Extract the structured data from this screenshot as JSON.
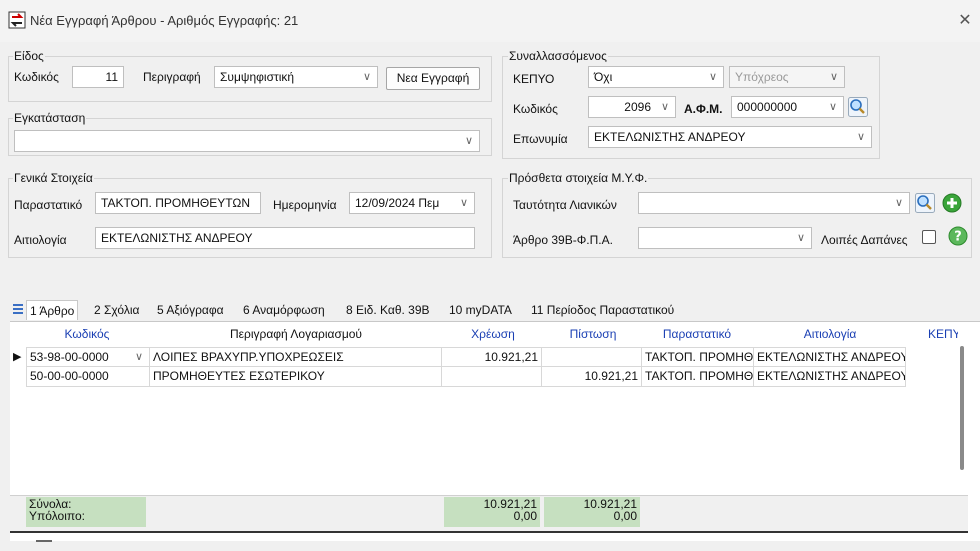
{
  "window": {
    "title": "Νέα Εγγραφή Άρθρου - Αριθμός Εγγραφής: 21",
    "close": "✕"
  },
  "eidos": {
    "legend": "Είδος",
    "code_label": "Κωδικός",
    "code_value": "11",
    "desc_label": "Περιγραφή",
    "desc_value": "Συμψηφιστική",
    "new_button": "Νεα Εγγραφή"
  },
  "egkatastasi": {
    "legend": "Εγκατάσταση",
    "value": ""
  },
  "synallassomenos": {
    "legend": "Συναλλασσόμενος",
    "kepyo_label": "ΚΕΠΥΟ",
    "kepyo_value": "Όχι",
    "ypoxreos_value": "Υπόχρεος",
    "code_label": "Κωδικός",
    "code_value": "2096",
    "afm_label": "Α.Φ.Μ.",
    "afm_value": "000000000",
    "name_label": "Επωνυμία",
    "name_value": "ΕΚΤΕΛΩΝΙΣΤΗΣ ΑΝΔΡΕΟΥ"
  },
  "genika": {
    "legend": "Γενικά Στοιχεία",
    "parastatiko_label": "Παραστατικό",
    "parastatiko_value": "ΤΑΚΤΟΠ. ΠΡΟΜΗΘΕΥΤΩΝ",
    "date_label": "Ημερομηνία",
    "date_value": "12/09/2024 Πεμ",
    "aitiologia_label": "Αιτιολογία",
    "aitiologia_value": "ΕΚΤΕΛΩΝΙΣΤΗΣ ΑΝΔΡΕΟΥ"
  },
  "prostheta": {
    "legend": "Πρόσθετα στοιχεία Μ.Υ.Φ.",
    "tautotita_label": "Ταυτότητα Λιανικών",
    "tautotita_value": "",
    "arthro_label": "Άρθρο 39Β-Φ.Π.Α.",
    "arthro_value": "",
    "loipes_label": "Λοιπές Δαπάνες"
  },
  "tabs": [
    {
      "label": "1 Άρθρο"
    },
    {
      "label": "2 Σχόλια"
    },
    {
      "label": "5 Αξιόγραφα"
    },
    {
      "label": "6 Αναμόρφωση"
    },
    {
      "label": "8 Ειδ. Καθ. 39Β"
    },
    {
      "label": "10 myDATA"
    },
    {
      "label": "11 Περίοδος Παραστατικού"
    }
  ],
  "grid": {
    "headers": [
      "Κωδικός",
      "Περιγραφή Λογαριασμού",
      "Χρέωση",
      "Πίστωση",
      "Παραστατικό",
      "Αιτιολογία",
      "ΚΕΠΥ"
    ],
    "rows": [
      {
        "code": "53-98-00-0000",
        "desc": "ΛΟΙΠΕΣ ΒΡΑΧΥΠΡ.ΥΠΟΧΡΕΩΣΕΙΣ",
        "debit": "10.921,21",
        "credit": "",
        "parastatiko": "ΤΑΚΤΟΠ. ΠΡΟΜΗΘΕ",
        "aitiologia": "ΕΚΤΕΛΩΝΙΣΤΗΣ ΑΝΔΡΕΟΥ"
      },
      {
        "code": "50-00-00-0000",
        "desc": "ΠΡΟΜΗΘΕΥΤΕΣ ΕΣΩΤΕΡΙΚΟΥ",
        "debit": "",
        "credit": "10.921,21",
        "parastatiko": "ΤΑΚΤΟΠ. ΠΡΟΜΗΘΕ",
        "aitiologia": "ΕΚΤΕΛΩΝΙΣΤΗΣ ΑΝΔΡΕΟΥ"
      }
    ],
    "totals_label": "Σύνολα:",
    "balance_label": "Υπόλοιπο:",
    "total_debit": "10.921,21",
    "total_credit": "10.921,21",
    "balance_debit": "0,00",
    "balance_credit": "0,00"
  },
  "colors": {
    "accent": "#1a3fb3",
    "totals_bg": "#c6e0c0",
    "add_green": "#3aa53a"
  }
}
